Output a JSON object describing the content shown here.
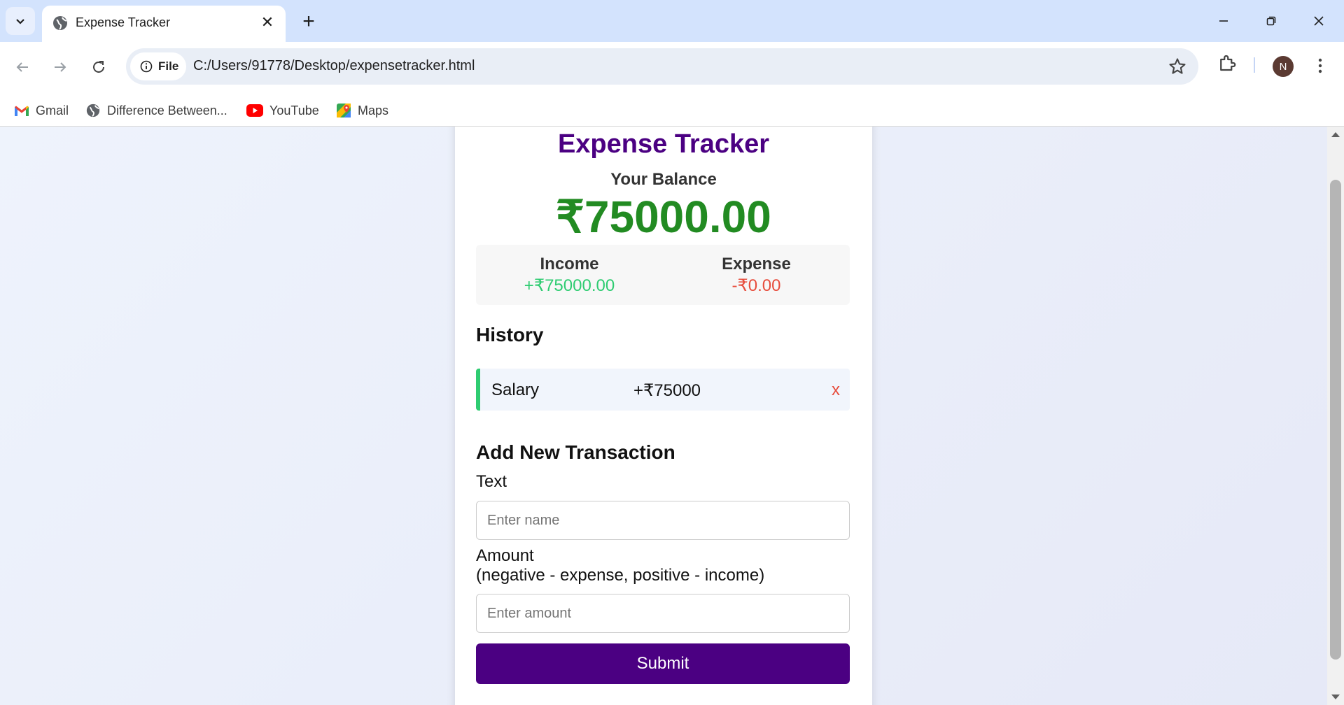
{
  "browser": {
    "tab_title": "Expense Tracker",
    "file_chip": "File",
    "url": "C:/Users/91778/Desktop/expensetracker.html",
    "avatar_initial": "N",
    "bookmarks": [
      {
        "label": "Gmail",
        "icon": "gmail-icon"
      },
      {
        "label": "Difference Between...",
        "icon": "globe-icon"
      },
      {
        "label": "YouTube",
        "icon": "youtube-icon"
      },
      {
        "label": "Maps",
        "icon": "maps-icon"
      }
    ]
  },
  "app": {
    "title": "Expense Tracker",
    "balance_label": "Your Balance",
    "balance_value": "₹75000.00",
    "income_label": "Income",
    "income_value": "+₹75000.00",
    "expense_label": "Expense",
    "expense_value": "-₹0.00",
    "history_heading": "History",
    "history": [
      {
        "text": "Salary",
        "amount": "+₹75000",
        "delete": "x"
      }
    ],
    "add_heading": "Add New Transaction",
    "text_label": "Text",
    "text_placeholder": "Enter name",
    "amount_label_line1": "Amount",
    "amount_label_line2": "(negative - expense, positive - income)",
    "amount_placeholder": "Enter amount",
    "submit_label": "Submit"
  },
  "colors": {
    "title": "#4b0082",
    "balance": "#228b22",
    "income": "#2ecc71",
    "expense": "#e74c3c",
    "submit_bg": "#4b0082"
  }
}
